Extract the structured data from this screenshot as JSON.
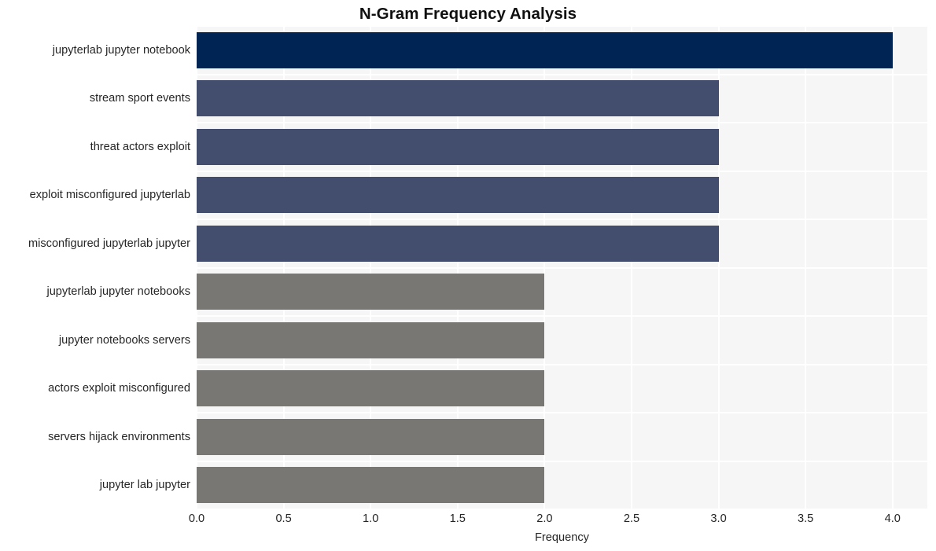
{
  "chart_data": {
    "type": "bar",
    "orientation": "horizontal",
    "title": "N-Gram Frequency Analysis",
    "xlabel": "Frequency",
    "ylabel": "",
    "xlim": [
      0,
      4.2
    ],
    "xticks": [
      "0.0",
      "0.5",
      "1.0",
      "1.5",
      "2.0",
      "2.5",
      "3.0",
      "3.5",
      "4.0"
    ],
    "xtick_values": [
      0.0,
      0.5,
      1.0,
      1.5,
      2.0,
      2.5,
      3.0,
      3.5,
      4.0
    ],
    "grid": true,
    "legend": "none",
    "categories": [
      "jupyterlab jupyter notebook",
      "stream sport events",
      "threat actors exploit",
      "exploit misconfigured jupyterlab",
      "misconfigured jupyterlab jupyter",
      "jupyterlab jupyter notebooks",
      "jupyter notebooks servers",
      "actors exploit misconfigured",
      "servers hijack environments",
      "jupyter lab jupyter"
    ],
    "values": [
      4,
      3,
      3,
      3,
      3,
      2,
      2,
      2,
      2,
      2
    ],
    "bar_colors": [
      "#002454",
      "#434e6e",
      "#434e6e",
      "#434e6e",
      "#434e6e",
      "#797774",
      "#797774",
      "#797774",
      "#797774",
      "#797774"
    ]
  },
  "style": {
    "plot_background": "#f6f6f7",
    "grid_color": "#ffffff",
    "page_background": "#ffffff",
    "text_color": "#262626",
    "title_color": "#101010"
  }
}
